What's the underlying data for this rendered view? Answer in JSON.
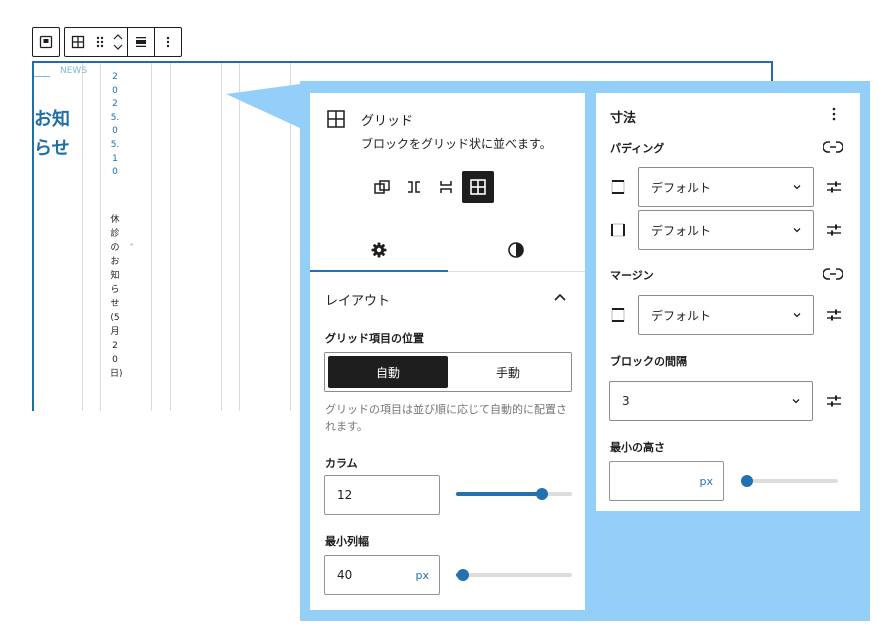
{
  "toolbar": {
    "items": [
      "parent-block-button",
      "grid-block-icon",
      "drag-handle",
      "move-up-down",
      "align-button",
      "more-options"
    ]
  },
  "canvas": {
    "news_label": "NEWS",
    "title": "お知らせ",
    "post_date": "2025.05.10",
    "post_title": "休診のお知らせ(5月20日)"
  },
  "block_card": {
    "title": "グリッド",
    "description": "ブロックをグリッド状に並べます。"
  },
  "settings": {
    "section_title": "レイアウト",
    "grid_position_label": "グリッド項目の位置",
    "position_options": [
      "自動",
      "手動"
    ],
    "position_selected": "自動",
    "help": "グリッドの項目は並び順に応じて自動的に配置されます。",
    "columns_label": "カラム",
    "columns_value": "12",
    "columns_slider_fraction": 0.74,
    "min_width_label": "最小列幅",
    "min_width_value": "40",
    "min_width_unit": "px",
    "min_width_slider_fraction": 0.06
  },
  "dimensions": {
    "title": "寸法",
    "padding_label": "パディング",
    "padding_vertical_value": "デフォルト",
    "padding_horizontal_value": "デフォルト",
    "margin_label": "マージン",
    "margin_value": "デフォルト",
    "block_spacing_label": "ブロックの間隔",
    "block_spacing_value": "3",
    "min_height_label": "最小の高さ",
    "min_height_value": "",
    "min_height_unit": "px",
    "min_height_slider_fraction": 0.0
  },
  "colors": {
    "accent": "#2271b1",
    "callout": "#93cff8",
    "dark": "#1e1e1e"
  }
}
